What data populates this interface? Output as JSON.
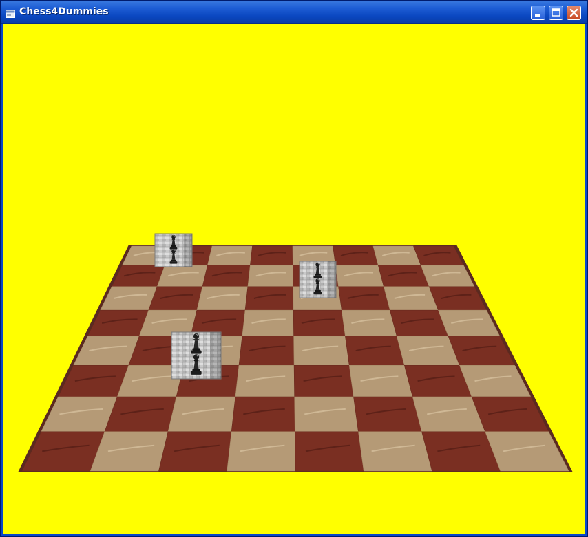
{
  "window": {
    "title": "Chess4Dummies"
  },
  "titlebar": {
    "icon": "app-window-icon",
    "buttons": [
      {
        "name": "minimize-button",
        "icon": "minimize-icon"
      },
      {
        "name": "maximize-button",
        "icon": "maximize-icon"
      },
      {
        "name": "close-button",
        "icon": "close-icon"
      }
    ]
  },
  "scene": {
    "background_color": "#ffff00",
    "board": {
      "size": "8x8",
      "light_square_color": "#b59a76",
      "dark_square_color": "#7a2f22",
      "frame_color": "#5a2a20"
    },
    "pieces": [
      {
        "type": "pawn",
        "color": "black",
        "icon": "pawn-icon",
        "texture": "stone-block"
      },
      {
        "type": "pawn",
        "color": "black",
        "icon": "pawn-icon",
        "texture": "stone-block"
      },
      {
        "type": "pawn",
        "color": "black",
        "icon": "pawn-icon",
        "texture": "stone-block"
      }
    ]
  }
}
